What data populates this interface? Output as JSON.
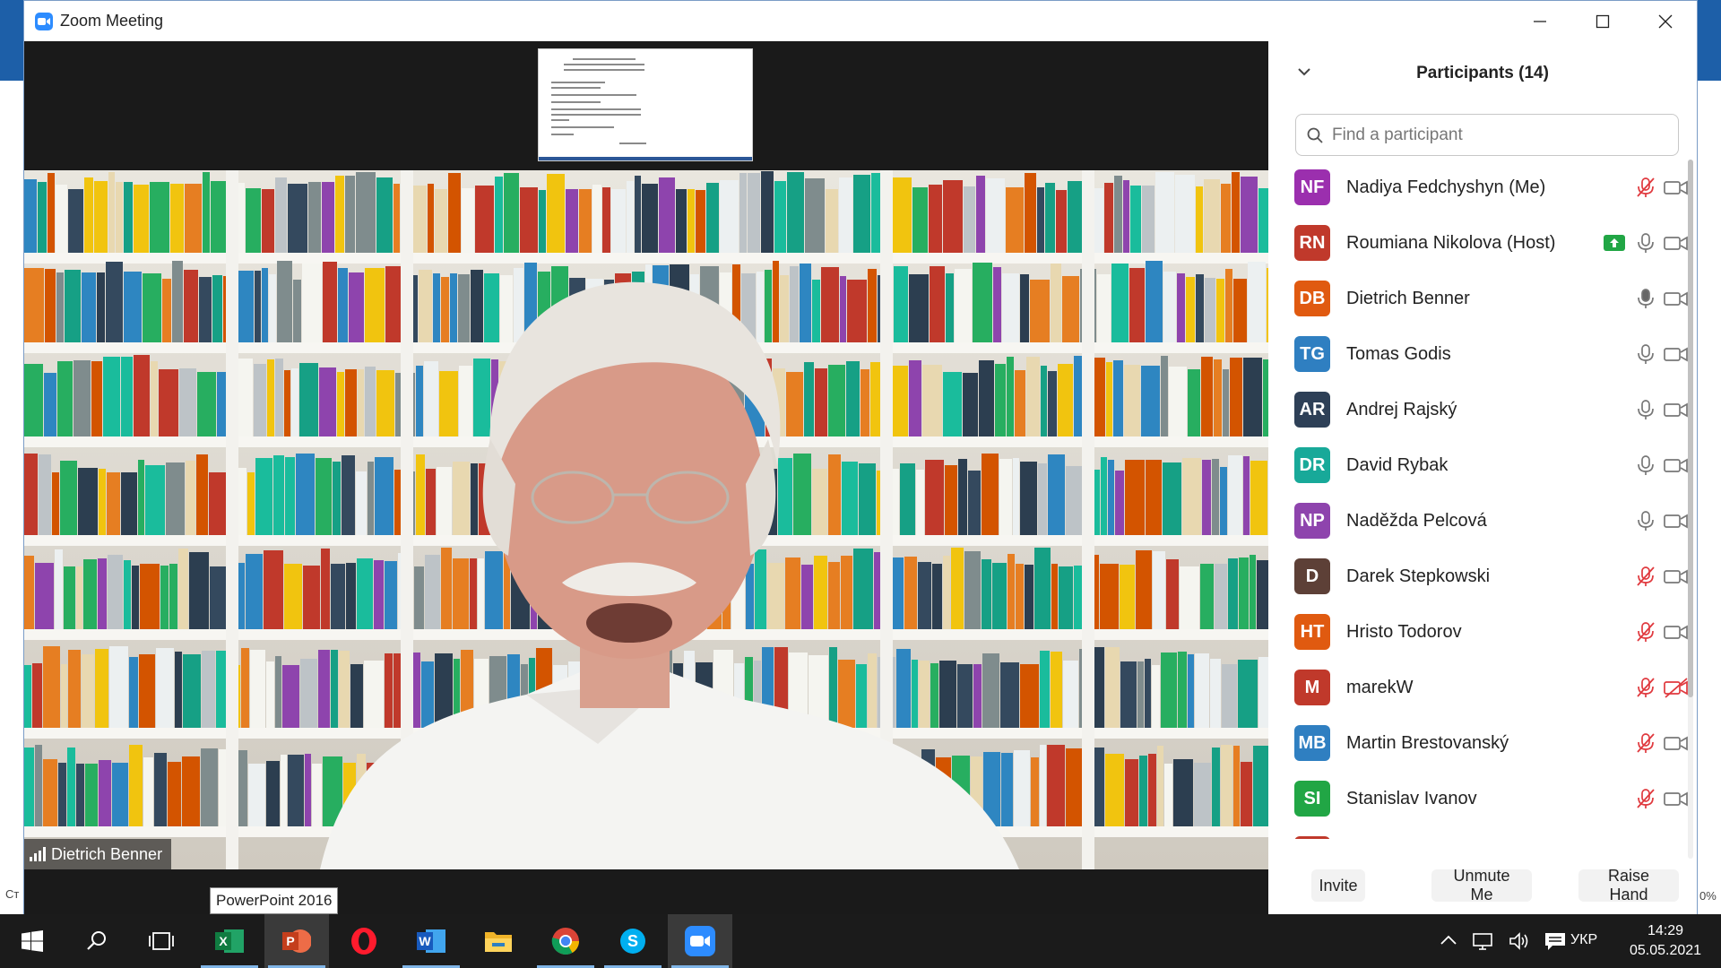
{
  "window": {
    "title": "Zoom Meeting"
  },
  "speaker": {
    "name": "Dietrich Benner"
  },
  "tooltip": {
    "text": "PowerPoint 2016"
  },
  "participants": {
    "title": "Participants (14)",
    "search_placeholder": "Find a participant",
    "list": [
      {
        "initials": "NF",
        "name": "Nadiya Fedchyshyn (Me)",
        "color": "#9b2fae",
        "mic": "muted",
        "video": "on",
        "sharing": false
      },
      {
        "initials": "RN",
        "name": "Roumiana Nikolova (Host)",
        "color": "#c0392b",
        "mic": "on",
        "video": "on",
        "sharing": true
      },
      {
        "initials": "DB",
        "name": "Dietrich Benner",
        "color": "#e05a10",
        "mic": "active",
        "video": "on",
        "sharing": false
      },
      {
        "initials": "TG",
        "name": "Tomas Godis",
        "color": "#2f7fc1",
        "mic": "on",
        "video": "on",
        "sharing": false
      },
      {
        "initials": "AR",
        "name": "Andrej Rajský",
        "color": "#2e4057",
        "mic": "on",
        "video": "on",
        "sharing": false
      },
      {
        "initials": "DR",
        "name": "David Rybak",
        "color": "#18a999",
        "mic": "on",
        "video": "on",
        "sharing": false
      },
      {
        "initials": "NP",
        "name": "Naděžda Pelcová",
        "color": "#8e44ad",
        "mic": "on",
        "video": "on",
        "sharing": false
      },
      {
        "initials": "D",
        "name": "Darek Stepkowski",
        "color": "#5d4037",
        "mic": "muted",
        "video": "on",
        "sharing": false
      },
      {
        "initials": "HT",
        "name": "Hristo Todorov",
        "color": "#e05a10",
        "mic": "muted",
        "video": "on",
        "sharing": false
      },
      {
        "initials": "M",
        "name": "marekW",
        "color": "#c0392b",
        "mic": "muted",
        "video": "off",
        "sharing": false
      },
      {
        "initials": "MB",
        "name": "Martin Brestovanský",
        "color": "#2f7fc1",
        "mic": "muted",
        "video": "on",
        "sharing": false
      },
      {
        "initials": "SI",
        "name": "Stanislav Ivanov",
        "color": "#21a645",
        "mic": "muted",
        "video": "on",
        "sharing": false
      },
      {
        "initials": "",
        "name": "",
        "color": "#c0392b",
        "mic": "",
        "video": "",
        "sharing": false
      }
    ],
    "actions": {
      "invite": "Invite",
      "unmute": "Unmute Me",
      "raise_hand": "Raise Hand"
    }
  },
  "taskbar": {
    "apps": [
      "windows-start-icon",
      "search-icon",
      "task-view-icon",
      "excel-icon",
      "powerpoint-icon",
      "opera-icon",
      "word-icon",
      "file-explorer-icon",
      "chrome-icon",
      "skype-icon",
      "zoom-icon"
    ],
    "language": "УКР",
    "time": "14:29",
    "date": "05.05.2021"
  },
  "background_app": {
    "left_status": "Ст",
    "right_status": "0%"
  },
  "colors": {
    "zoom_blue": "#2d8cff",
    "muted_red": "#e0393e",
    "taskbar": "#1b1b1b"
  }
}
